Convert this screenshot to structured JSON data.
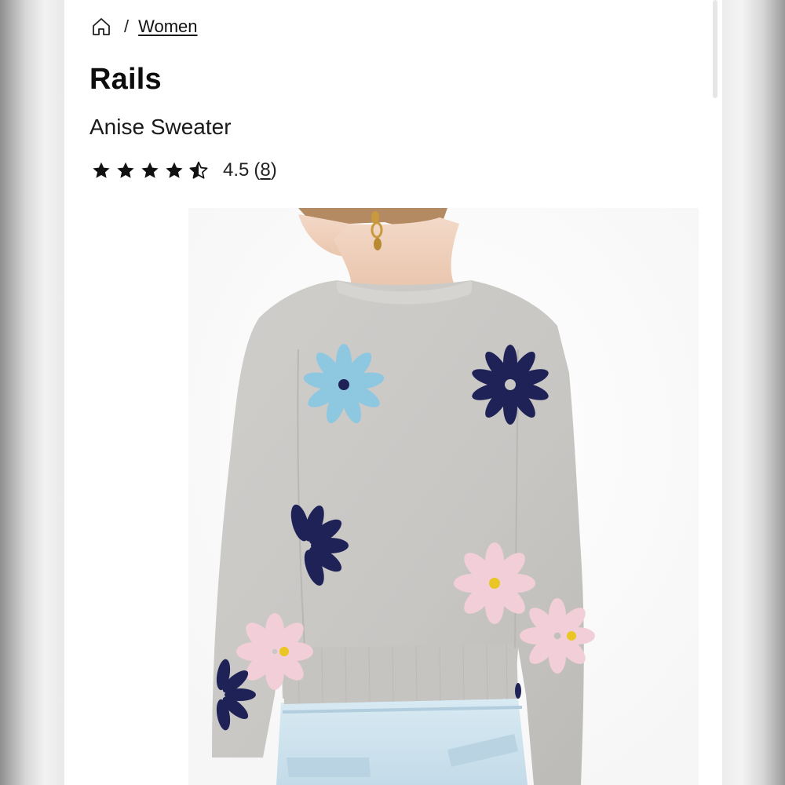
{
  "breadcrumb": {
    "home_icon": "home-icon",
    "separator": "/",
    "current": "Women"
  },
  "product": {
    "brand": "Rails",
    "name": "Anise Sweater",
    "rating": {
      "stars_filled": 4.5,
      "stars_total": 5,
      "value_text": "4.5",
      "count_open": "(",
      "count": "8",
      "count_close": ")"
    },
    "image": {
      "subject": "sweater-back-view",
      "colors": {
        "sweater": "#c9c7c4",
        "navy_flower": "#1f2257",
        "blue_flower": "#8ec7e0",
        "pink_flower": "#f2cfd8",
        "flower_center": "#e9c624",
        "jeans": "#cfe3ee"
      }
    }
  }
}
